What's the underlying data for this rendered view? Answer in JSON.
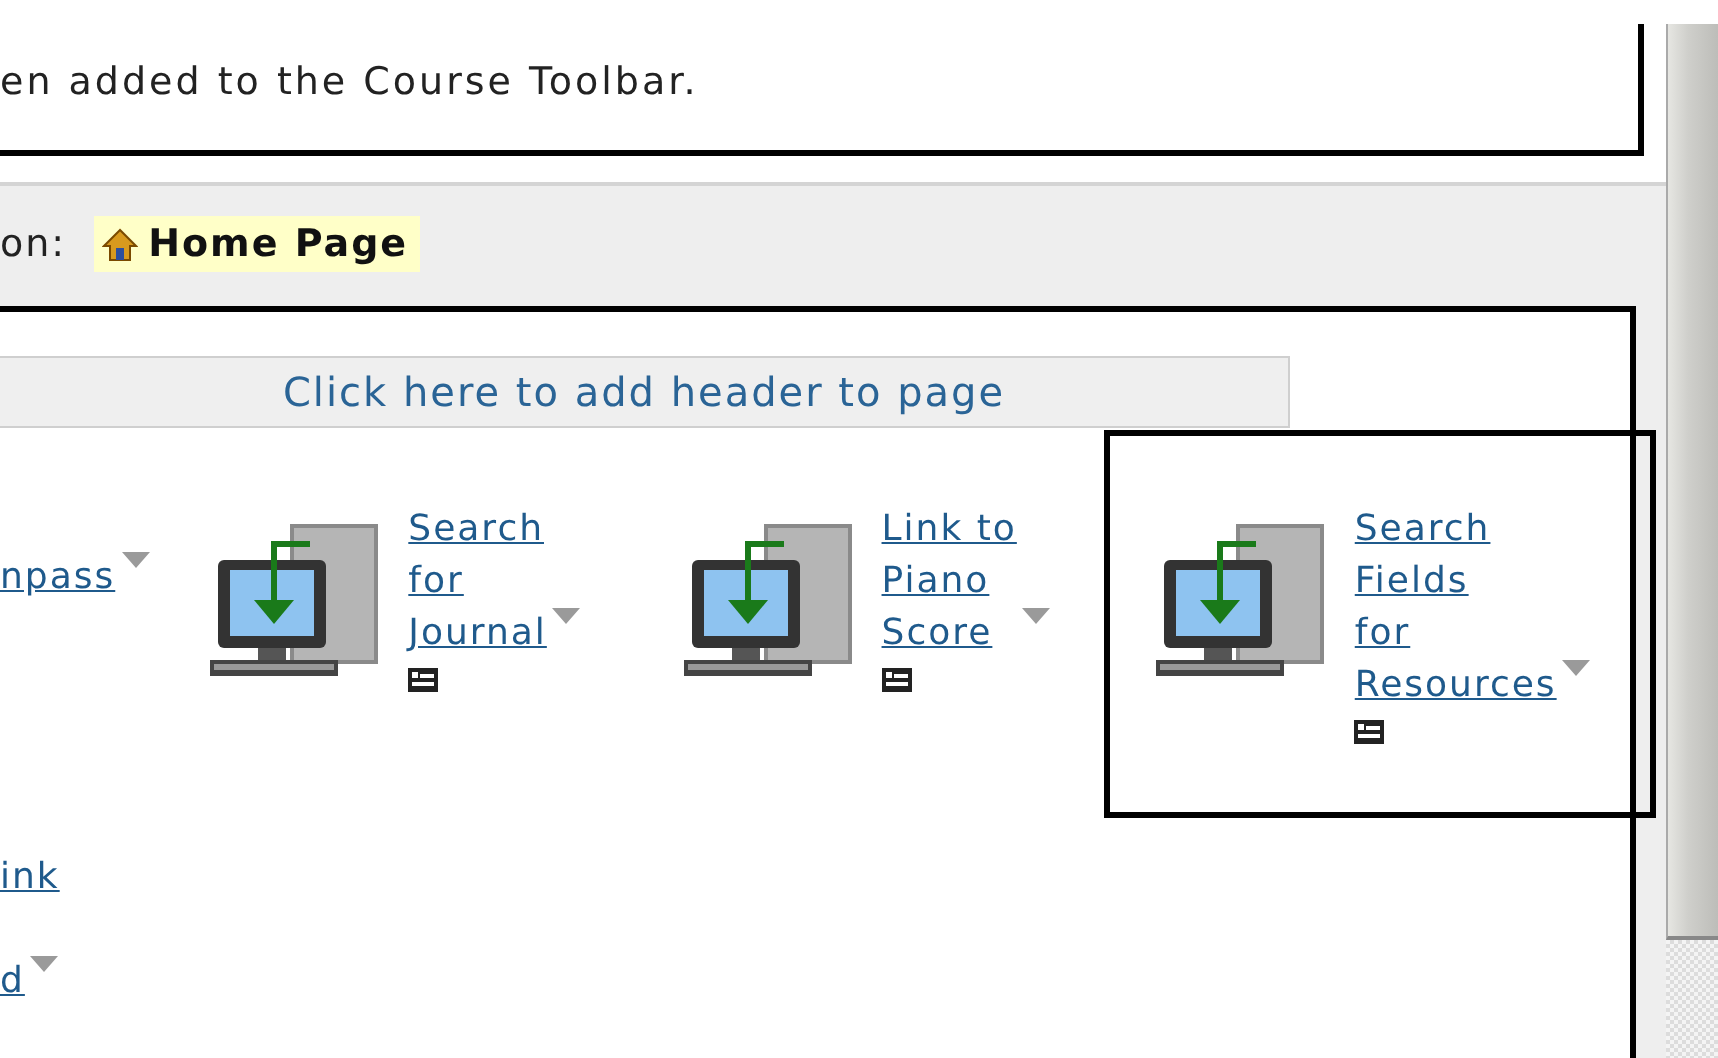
{
  "notice": "en added to the Course Toolbar.",
  "breadcrumb": {
    "label": "on:",
    "page": "Home Page"
  },
  "header_button": "Click here to add header to page",
  "partial_item": {
    "line": "npass"
  },
  "items": [
    {
      "lines": [
        "Search",
        "for",
        "Journal"
      ],
      "highlighted": false
    },
    {
      "lines": [
        "Link to",
        "Piano",
        "Score"
      ],
      "highlighted": false
    },
    {
      "lines": [
        "Search",
        "Fields",
        "for",
        "Resources"
      ],
      "highlighted": true
    }
  ],
  "lower_links": [
    {
      "text": "ink",
      "menu": false
    },
    {
      "text": "d",
      "menu": true
    }
  ]
}
